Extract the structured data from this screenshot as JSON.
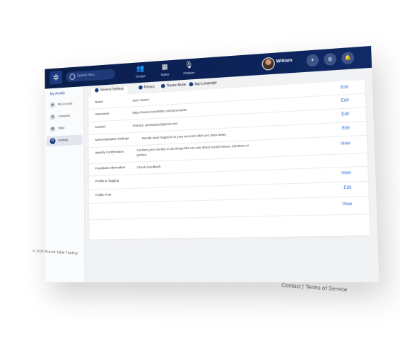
{
  "header": {
    "search_placeholder": "Search here...",
    "nav": [
      {
        "label": "Groups",
        "icon": "groups-icon"
      },
      {
        "label": "Tables",
        "icon": "tables-icon"
      },
      {
        "label": "Chatters",
        "icon": "chatters-icon"
      }
    ],
    "user_name": "William"
  },
  "sidebar": {
    "title": "My Profile",
    "items": [
      {
        "label": "My Account",
        "icon": "account-icon"
      },
      {
        "label": "Company",
        "icon": "company-icon"
      },
      {
        "label": "Table",
        "icon": "table-icon"
      },
      {
        "label": "Settings",
        "icon": "settings-icon",
        "active": true
      }
    ]
  },
  "tabs": [
    {
      "label": "General Settings",
      "active": true
    },
    {
      "label": "Privacy"
    },
    {
      "label": "Theme Mode"
    },
    {
      "label": "App Language"
    }
  ],
  "settings_rows": [
    {
      "label": "Name",
      "value": "Jane Saeter",
      "action": "Edit"
    },
    {
      "label": "Username",
      "value": "https://www.roundtable.com/janesaeter",
      "action": "Edit"
    },
    {
      "label": "Contact",
      "value": "Primary: janesaeter@gmail.com",
      "action": "Edit"
    },
    {
      "label": "Memorialization Settings",
      "value": "Decide what happens to your account after you pass away.",
      "action": "Edit"
    },
    {
      "label": "Identity Confirmation",
      "value": "Confirm your identity to do things like run ads about social issues, elections or politics.",
      "action": "View"
    },
    {
      "label": "Feedback Information",
      "value": "Check Feedback",
      "action": ""
    },
    {
      "label": "Profile & Tagging",
      "value": "",
      "action": "View"
    },
    {
      "label": "Public Post",
      "value": "",
      "action": "Edit"
    },
    {
      "label": "",
      "value": "",
      "action": "View"
    }
  ],
  "footer": {
    "copyright": "© 2021 Round Table Trading",
    "contact": "Contact",
    "separator": "|",
    "terms": "Terms of Service"
  }
}
